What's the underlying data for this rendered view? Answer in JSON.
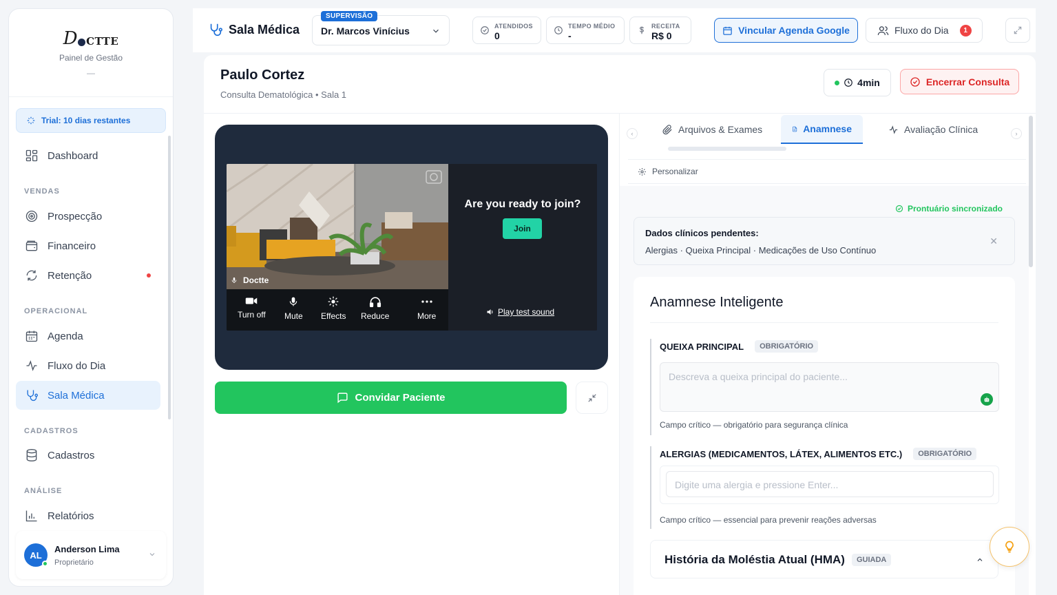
{
  "app": {
    "logo_first": "D",
    "logo_rest": "CTTE",
    "subtitle": "Painel de Gestão",
    "dash": "—"
  },
  "sidebar": {
    "trial": "Trial: 10 dias restantes",
    "sections": {
      "vendas": "VENDAS",
      "operacional": "OPERACIONAL",
      "cadastros": "CADASTROS",
      "analise": "ANÁLISE"
    },
    "items": {
      "dashboard": "Dashboard",
      "prospeccao": "Prospecção",
      "financeiro": "Financeiro",
      "retencao": "Retenção",
      "agenda": "Agenda",
      "fluxo": "Fluxo do Dia",
      "sala": "Sala Médica",
      "cadastros": "Cadastros",
      "relatorios": "Relatórios"
    },
    "user": {
      "initials": "AL",
      "name": "Anderson Lima",
      "role": "Proprietário"
    }
  },
  "header": {
    "title": "Sala Médica",
    "supervision_badge": "SUPERVISÃO",
    "doctor": "Dr. Marcos Vinícius",
    "stats": {
      "atendidos_label": "ATENDIDOS",
      "atendidos_value": "0",
      "tempo_label": "TEMPO MÉDIO",
      "tempo_value": "-",
      "receita_label": "RECEITA",
      "receita_value": "R$ 0"
    },
    "google_button": "Vincular Agenda Google",
    "fluxo_button": "Fluxo do Dia",
    "fluxo_count": "1"
  },
  "consult": {
    "patient": "Paulo Cortez",
    "subtitle": "Consulta Dematológica • Sala 1",
    "timer": "4min",
    "end_button": "Encerrar Consulta"
  },
  "video": {
    "camera_name": "Doctte",
    "controls": {
      "turn_off": "Turn off",
      "mute": "Mute",
      "effects": "Effects",
      "reduce": "Reduce",
      "more": "More"
    },
    "ready_title": "Are you ready to join?",
    "join": "Join",
    "test_sound": "Play test sound",
    "invite_button": "Convidar Paciente"
  },
  "panel": {
    "tabs": {
      "arquivos": "Arquivos & Exames",
      "anamnese": "Anamnese",
      "avaliacao": "Avaliação Clínica"
    },
    "personalizar": "Personalizar",
    "sync": "Prontuário sincronizado",
    "pending_title": "Dados clínicos pendentes:",
    "pending_list": "Alergias · Queixa Principal · Medicações de Uso Contínuo",
    "anamnese_title": "Anamnese Inteligente",
    "queixa_label": "QUEIXA PRINCIPAL",
    "required": "OBRIGATÓRIO",
    "queixa_placeholder": "Descreva a queixa principal do paciente...",
    "queixa_hint": "Campo crítico — obrigatório para segurança clínica",
    "alergias_label": "ALERGIAS (MEDICAMENTOS, LÁTEX, ALIMENTOS ETC.)",
    "alergias_placeholder": "Digite uma alergia e pressione Enter...",
    "alergias_hint": "Campo crítico — essencial para prevenir reações adversas",
    "hma_title": "História da Moléstia Atual (HMA)",
    "hma_badge": "GUIADA"
  },
  "colors": {
    "primary": "#1d6fd8",
    "success": "#22c55e",
    "danger": "#ef4444",
    "video_bg": "#1f2b3d"
  }
}
